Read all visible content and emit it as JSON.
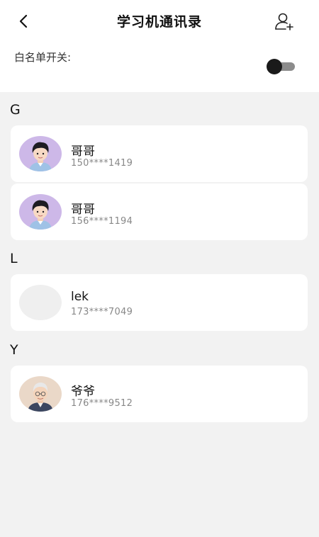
{
  "header": {
    "title": "学习机通讯录",
    "back_icon": "chevron-left-icon",
    "add_icon": "add-user-icon"
  },
  "whitelist": {
    "label": "白名单开关:",
    "enabled": false
  },
  "sections": [
    {
      "letter": "G",
      "contacts": [
        {
          "name": "哥哥",
          "phone": "150****1419",
          "avatar": "boy-avatar"
        },
        {
          "name": "哥哥",
          "phone": "156****1194",
          "avatar": "boy-avatar"
        }
      ]
    },
    {
      "letter": "L",
      "contacts": [
        {
          "name": "lek",
          "phone": "173****7049",
          "avatar": "blank-avatar"
        }
      ]
    },
    {
      "letter": "Y",
      "contacts": [
        {
          "name": "爷爷",
          "phone": "176****9512",
          "avatar": "grandpa-avatar"
        }
      ]
    }
  ],
  "colors": {
    "background": "#f2f2f2",
    "card": "#ffffff",
    "avatar_purple": "#cdb8e8",
    "toggle_knob": "#1a1a1a",
    "toggle_track": "#8c8c8c"
  }
}
